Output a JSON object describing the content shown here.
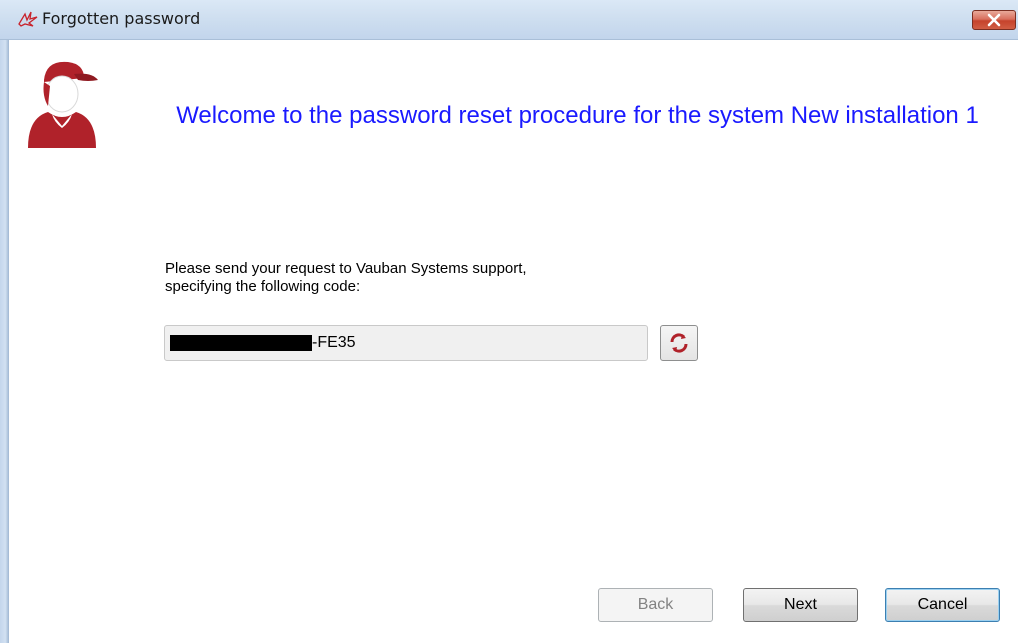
{
  "window": {
    "title": "Forgotten password"
  },
  "welcome": {
    "text": "Welcome to the password reset procedure for the system  New installation 1"
  },
  "instruction": {
    "line1": "Please send your request to Vauban Systems support,",
    "line2": "specifying the following code:"
  },
  "code": {
    "visible_suffix": "-FE35"
  },
  "buttons": {
    "back": "Back",
    "next": "Next",
    "cancel": "Cancel"
  },
  "icons": {
    "title": "vauban-logo-icon",
    "avatar": "support-agent-icon",
    "refresh": "refresh-icon",
    "close": "close-icon"
  },
  "colors": {
    "welcome_text": "#1a1aff",
    "close_button": "#c5432c",
    "avatar_red": "#b0222a"
  }
}
